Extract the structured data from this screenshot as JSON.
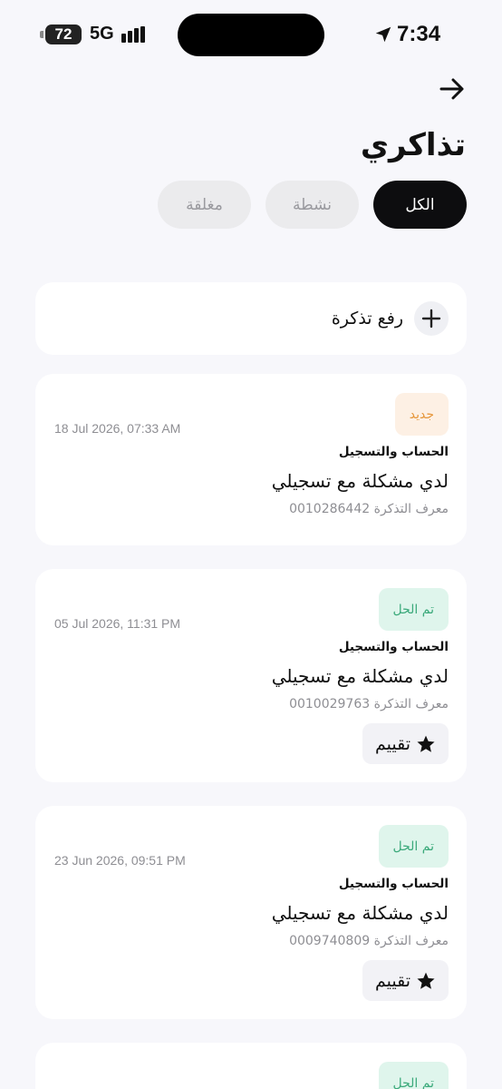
{
  "status_bar": {
    "battery": "72",
    "network": "5G",
    "time": "7:34"
  },
  "header": {
    "title": "تذاكري",
    "back_icon": "arrow-right-icon"
  },
  "tabs": [
    {
      "label": "الكل",
      "active": true
    },
    {
      "label": "نشطة",
      "active": false
    },
    {
      "label": "مغلقة",
      "active": false
    }
  ],
  "raise_ticket": {
    "label": "رفع تذكرة",
    "icon": "plus-icon"
  },
  "tickets": [
    {
      "status": "جديد",
      "status_type": "new",
      "date": "18 Jul 2026, 07:33 AM",
      "category": "الحساب والتسجيل",
      "title": "لدي مشكلة مع تسجيلي",
      "id_text": "معرف التذكرة 0010286442"
    },
    {
      "status": "تم الحل",
      "status_type": "resolved",
      "date": "05 Jul 2026, 11:31 PM",
      "category": "الحساب والتسجيل",
      "title": "لدي مشكلة مع تسجيلي",
      "id_text": "معرف التذكرة 0010029763",
      "rate_label": "تقييم"
    },
    {
      "status": "تم الحل",
      "status_type": "resolved",
      "date": "23 Jun 2026, 09:51 PM",
      "category": "الحساب والتسجيل",
      "title": "لدي مشكلة مع تسجيلي",
      "id_text": "معرف التذكرة 0009740809",
      "rate_label": "تقييم"
    },
    {
      "status": "تم الحل",
      "status_type": "resolved"
    }
  ],
  "colors": {
    "background": "#f7f7fb",
    "active_tab": "#0d0d0f",
    "new_badge_bg": "#fdf0e4",
    "new_badge_text": "#e6963a",
    "resolved_badge_bg": "#dff5ec",
    "resolved_badge_text": "#3aa97a"
  }
}
